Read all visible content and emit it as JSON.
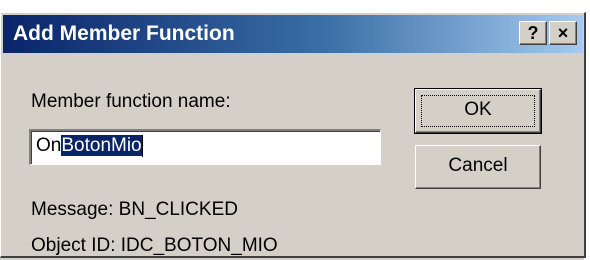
{
  "window": {
    "title": "Add Member Function",
    "help_label": "?",
    "close_label": "×"
  },
  "form": {
    "name_label": "Member function name:",
    "name_value_unselected": "On",
    "name_value_selected": "BotonMio"
  },
  "buttons": {
    "ok_label": "OK",
    "cancel_label": "Cancel"
  },
  "info": {
    "message": "Message: BN_CLICKED",
    "object_id": "Object ID: IDC_BOTON_MIO"
  },
  "colors": {
    "titlebar_start": "#0a246a",
    "titlebar_end": "#a6caf0",
    "selection": "#0a246a",
    "face": "#d4d0c8"
  }
}
